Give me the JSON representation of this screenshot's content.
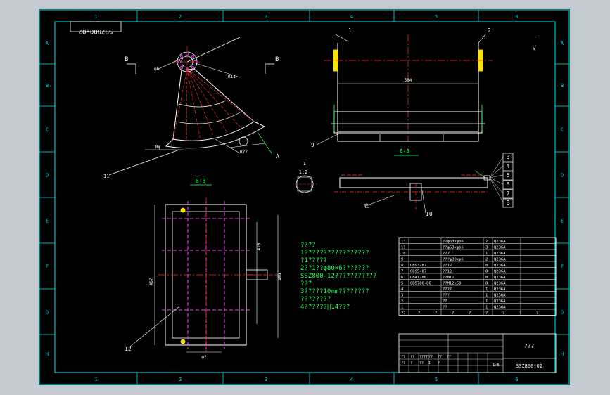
{
  "drawing_number_rotated": "SSZ800-02",
  "frame_numbers_top": [
    "1",
    "2",
    "3",
    "4",
    "5",
    "6"
  ],
  "frame_numbers_bottom": [
    "1",
    "2",
    "3",
    "4",
    "5",
    "6"
  ],
  "frame_letters_left": [
    "A",
    "B",
    "C",
    "D",
    "E",
    "F",
    "G",
    "H"
  ],
  "frame_letters_right": [
    "A",
    "B",
    "C",
    "D",
    "E",
    "F",
    "G",
    "H"
  ],
  "view_labels": {
    "section_aa": "A-A",
    "section_bb": "B-B",
    "marker_b_left": "B",
    "marker_b_right": "B",
    "marker_a": "A",
    "detail_label": "I",
    "detail_scale": "1:2"
  },
  "balloons": [
    "1",
    "2",
    "3",
    "4",
    "5",
    "6",
    "7",
    "8",
    "9",
    "10",
    "11",
    "12"
  ],
  "roughness": [
    "一",
    ""
  ],
  "notes": [
    "????",
    "1?????????????????",
    "  ?1?????",
    "2??1??φ80×6???????",
    "  SSZ800-12???????????",
    "  ???",
    "3?????10mm????????",
    "  ????????",
    "4??????∏14???"
  ],
  "bom_rows": [
    {
      "no": "13",
      "code": "",
      "name": "??φ53xφb6",
      "qty": "2",
      "mat": "Q236A"
    },
    {
      "no": "11",
      "code": "",
      "name": "??φ53xφb6",
      "qty": "3",
      "mat": "Q236A"
    },
    {
      "no": "10",
      "code": "",
      "name": "???",
      "qty": "1",
      "mat": "Q236A"
    },
    {
      "no": "9",
      "code": "",
      "name": "???φ30xφ6",
      "qty": "2",
      "mat": "Q236A"
    },
    {
      "no": "8",
      "code": "GB93-87",
      "name": "??12",
      "qty": "8",
      "mat": "Q236A"
    },
    {
      "no": "7",
      "code": "GB95-87",
      "name": "??12",
      "qty": "8",
      "mat": "Q236A"
    },
    {
      "no": "6",
      "code": "GB41-86",
      "name": "??M12",
      "qty": "8",
      "mat": "Q236A"
    },
    {
      "no": "5",
      "code": "GB5780-86",
      "name": "??M12x50",
      "qty": "8",
      "mat": "Q236A"
    },
    {
      "no": "4",
      "code": "",
      "name": "????",
      "qty": "1",
      "mat": "Q236A"
    },
    {
      "no": "3",
      "code": "",
      "name": "???",
      "qty": "1",
      "mat": "Q236A"
    },
    {
      "no": "2",
      "code": "",
      "name": "??",
      "qty": "1",
      "mat": "Q236A"
    },
    {
      "no": "1",
      "code": "",
      "name": "??",
      "qty": "1",
      "mat": "Q236A"
    }
  ],
  "bom_header": [
    "??",
    "?",
    "?",
    "?",
    "?",
    "?",
    "?",
    "?",
    "?"
  ],
  "title_block": {
    "name": "???",
    "drawing_no": "SSZ800-02",
    "scale": "1:5",
    "cells": [
      "??",
      "??",
      "????",
      "??",
      "??",
      "??",
      "??",
      "?",
      "??",
      "1",
      "?"
    ]
  },
  "dims": [
    "Rφ",
    "R11",
    "φb",
    "R??",
    "584",
    "410",
    "467",
    "409",
    "φ?",
    "φ?",
    "φ?",
    "φ?"
  ]
}
